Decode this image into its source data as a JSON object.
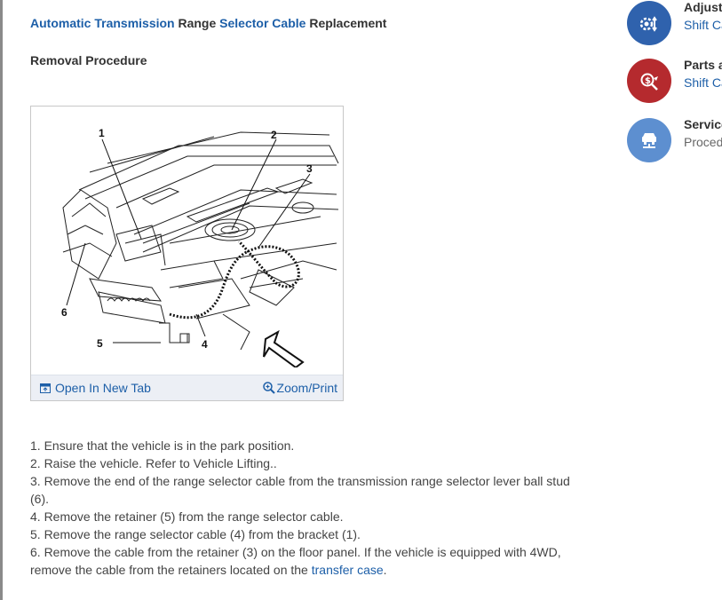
{
  "header": {
    "title_parts": [
      "Automatic Transmission",
      " Range ",
      "Selector Cable",
      " Replacement"
    ],
    "subheading": "Removal Procedure"
  },
  "figure": {
    "callouts": [
      "1",
      "2",
      "3",
      "4",
      "5",
      "6"
    ],
    "open_tab_label": "Open In New Tab",
    "zoom_label": "Zoom/Print"
  },
  "steps": [
    {
      "text": "1. Ensure that the vehicle is in the park position."
    },
    {
      "text": "2. Raise the vehicle. Refer to Vehicle Lifting.."
    },
    {
      "text": "3. Remove the end of the range selector cable from the transmission range selector lever ball stud (6)."
    },
    {
      "text": "4. Remove the retainer (5) from the range selector cable."
    },
    {
      "text": "5. Remove the range selector cable (4) from the bracket (1)."
    },
    {
      "text": "6. Remove the cable from the retainer (3) on the floor panel. If the vehicle is equipped with 4WD, remove the cable from the retainers located on the ",
      "link": "transfer case",
      "after": "."
    }
  ],
  "sidebar": {
    "items": [
      {
        "title": "Adjustment",
        "sub": "Shift Cable",
        "color": "#2f62ad",
        "icon": "gear-adjust-icon"
      },
      {
        "title": "Parts and Labor",
        "sub": "Shift Cable",
        "color": "#b52a2e",
        "icon": "dollar-wrench-icon"
      },
      {
        "title": "Service",
        "sub": "Procedure",
        "color": "#5d8fd0",
        "icon": "vehicle-lift-icon"
      }
    ]
  }
}
